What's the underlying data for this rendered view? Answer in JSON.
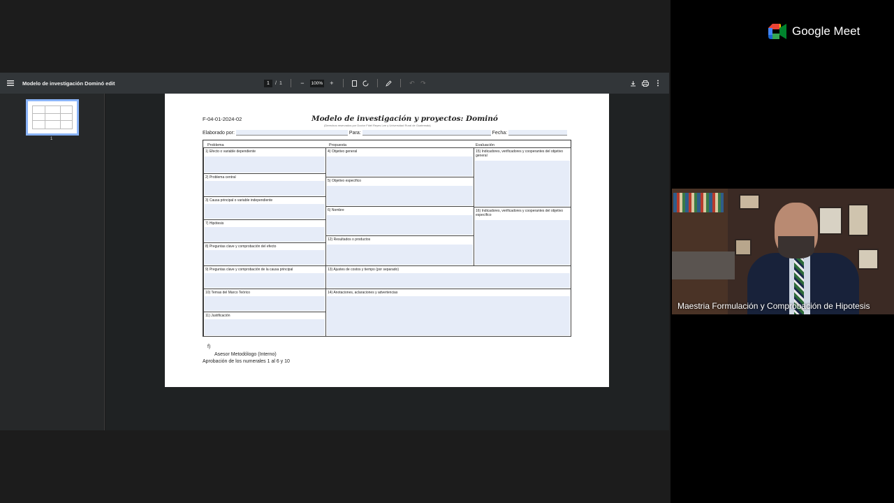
{
  "pdf_viewer": {
    "title": "Modelo de investigación Dominó edit",
    "page_current": "1",
    "page_separator": "/",
    "page_total": "1",
    "zoom": "100%",
    "thumbnail_page": "1"
  },
  "document": {
    "code": "F-04-01-2024-02",
    "title": "Modelo de investigación y proyectos: Dominó",
    "rights": "(Derechos reservados por Doctor Fidel Reyes Lee y Universidad Rural de Guatemala)",
    "elaborado_label": "Elaborado por:",
    "para_label": "Para:",
    "fecha_label": "Fecha:",
    "headers": {
      "problema": "Problema",
      "propuesta": "Propuesta",
      "evaluacion": "Evaluación"
    },
    "cells": {
      "c1": "1) Efecto o variable dependiente",
      "c2": "2) Problema central",
      "c3": "3) Causa principal o variable independiente",
      "c7": "7) Hipótesis",
      "c8": "8) Preguntas clave y comprobación del efecto",
      "c9": "9) Preguntas clave  y comprobación de la causa principal",
      "c10": "10) Temas del Marco Teórico",
      "c11": "11) Justificación",
      "c4": "4) Objetivo general",
      "c5": "5) Objetivo específico",
      "c6": "6) Nombre",
      "c12": "12) Resultados o productos",
      "c13": "13) Ajustes de costos y tiempo (por separado)",
      "c14": "14) Anotaciones, aclaraciones y advertencias",
      "c15": "15) Indicadores, verificadores y cooperantes del objetivo general",
      "c16": "16) Indicadores, verificadores y cooperantes del objetivo específico"
    },
    "footer": {
      "f": "f)",
      "asesor": "Asesor Metodólogo (Interno)",
      "aprobacion": "Aprobación de los numerales 1 al 6 y 10"
    }
  },
  "meet": {
    "brand": "Google Meet",
    "participant_name": "Maestria Formulación y Comprobación de Hipotesis"
  },
  "colors": {
    "toolbar": "#323639",
    "thumbnail_border": "#8ab4f8",
    "field_fill": "#e6ecf8"
  }
}
